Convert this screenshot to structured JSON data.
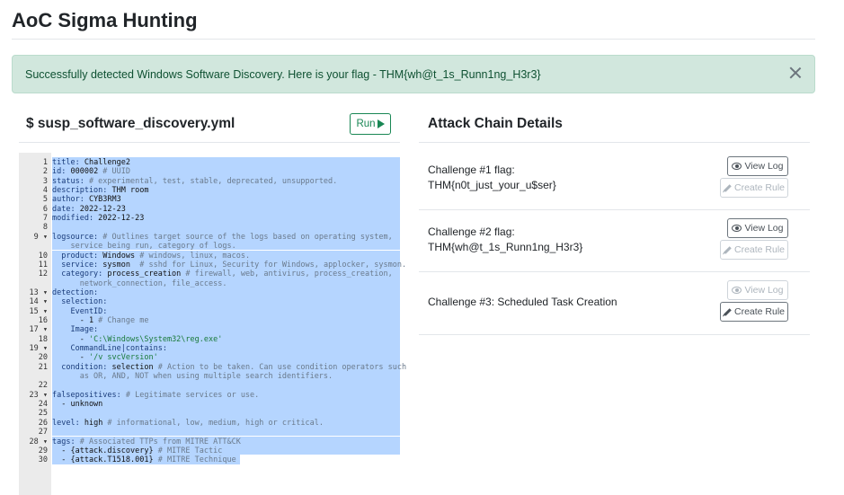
{
  "page": {
    "title": "AoC Sigma Hunting"
  },
  "alert": {
    "message": "Successfully detected Windows Software Discovery. Here is your flag - THM{wh@t_1s_Runn1ng_H3r3}",
    "close_icon": "close-icon"
  },
  "editor": {
    "filename": "$ susp_software_discovery.yml",
    "run_label": "Run",
    "run_icon": "play-icon",
    "lines": [
      {
        "n": "1",
        "k": "title:",
        "v": " Challenge2",
        "c": ""
      },
      {
        "n": "2",
        "k": "id:",
        "v": " 000002",
        "c": " # UUID"
      },
      {
        "n": "3",
        "k": "status:",
        "v": "",
        "c": " # experimental, test, stable, deprecated, unsupported."
      },
      {
        "n": "4",
        "k": "description:",
        "v": " THM room",
        "c": ""
      },
      {
        "n": "5",
        "k": "author:",
        "v": " CYB3RM3",
        "c": ""
      },
      {
        "n": "6",
        "k": "date:",
        "v": " 2022-12-23",
        "c": ""
      },
      {
        "n": "7",
        "k": "modified:",
        "v": " 2022-12-23",
        "c": ""
      },
      {
        "n": "8",
        "k": "",
        "v": "",
        "c": ""
      },
      {
        "n": "9 ▾",
        "k": "logsource:",
        "v": "",
        "c": " # Outlines target source of the logs based on operating system,"
      },
      {
        "n": "",
        "k": "",
        "v": "",
        "c": "    service being run, category of logs."
      },
      {
        "n": "10",
        "k": "  product:",
        "v": " Windows",
        "c": " # windows, linux, macos."
      },
      {
        "n": "11",
        "k": "  service:",
        "v": " sysmon",
        "c": "  # sshd for Linux, Security for Windows, applocker, sysmon."
      },
      {
        "n": "12",
        "k": "  category:",
        "v": " process_creation",
        "c": " # firewall, web, antivirus, process_creation,"
      },
      {
        "n": "",
        "k": "",
        "v": "",
        "c": "      network_connection, file_access."
      },
      {
        "n": "13 ▾",
        "k": "detection:",
        "v": "",
        "c": ""
      },
      {
        "n": "14 ▾",
        "k": "  selection:",
        "v": "",
        "c": ""
      },
      {
        "n": "15 ▾",
        "k": "    EventID:",
        "v": "",
        "c": ""
      },
      {
        "n": "16",
        "k": "",
        "v": "      - 1",
        "c": " # Change me"
      },
      {
        "n": "17 ▾",
        "k": "    Image:",
        "v": "",
        "c": ""
      },
      {
        "n": "18",
        "k": "",
        "v": "      - ",
        "c": "",
        "s": "'C:\\Windows\\System32\\reg.exe'"
      },
      {
        "n": "19 ▾",
        "k": "    CommandLine|contains:",
        "v": "",
        "c": ""
      },
      {
        "n": "20",
        "k": "",
        "v": "      - ",
        "c": "",
        "s": "'/v svcVersion'"
      },
      {
        "n": "21",
        "k": "  condition:",
        "v": " selection",
        "c": " # Action to be taken. Can use condition operators such"
      },
      {
        "n": "",
        "k": "",
        "v": "",
        "c": "      as OR, AND, NOT when using multiple search identifiers."
      },
      {
        "n": "22",
        "k": "",
        "v": "",
        "c": ""
      },
      {
        "n": "23 ▾",
        "k": "falsepositives:",
        "v": "",
        "c": " # Legitimate services or use."
      },
      {
        "n": "24",
        "k": "",
        "v": "  - unknown",
        "c": ""
      },
      {
        "n": "25",
        "k": "",
        "v": "",
        "c": ""
      },
      {
        "n": "26",
        "k": "level:",
        "v": " high",
        "c": " # informational, low, medium, high or critical."
      },
      {
        "n": "27",
        "k": "",
        "v": "",
        "c": ""
      },
      {
        "n": "28 ▾",
        "k": "tags:",
        "v": "",
        "c": " # Associated TTPs from MITRE ATT&CK"
      },
      {
        "n": "29",
        "k": "",
        "v": "  - {attack.discovery}",
        "c": " # MITRE Tactic"
      },
      {
        "n": "30",
        "k": "",
        "v": "  - {attack.T1518.001}",
        "c": " # MITRE Technique"
      }
    ]
  },
  "attack_chain": {
    "title": "Attack Chain Details",
    "view_log_label": "View Log",
    "create_rule_label": "Create Rule",
    "challenges": [
      {
        "line1": "Challenge #1 flag:",
        "line2": "THM{n0t_just_your_u$ser}",
        "view_enabled": true,
        "create_enabled": false
      },
      {
        "line1": "Challenge #2 flag:",
        "line2": "THM{wh@t_1s_Runn1ng_H3r3}",
        "view_enabled": true,
        "create_enabled": false
      },
      {
        "line1": "Challenge #3: Scheduled Task Creation",
        "line2": "",
        "view_enabled": false,
        "create_enabled": true
      }
    ]
  },
  "colors": {
    "success_bg": "#d1e7dd",
    "success_text": "#0f5132",
    "run_green": "#198754",
    "selection": "#b5d5ff"
  }
}
